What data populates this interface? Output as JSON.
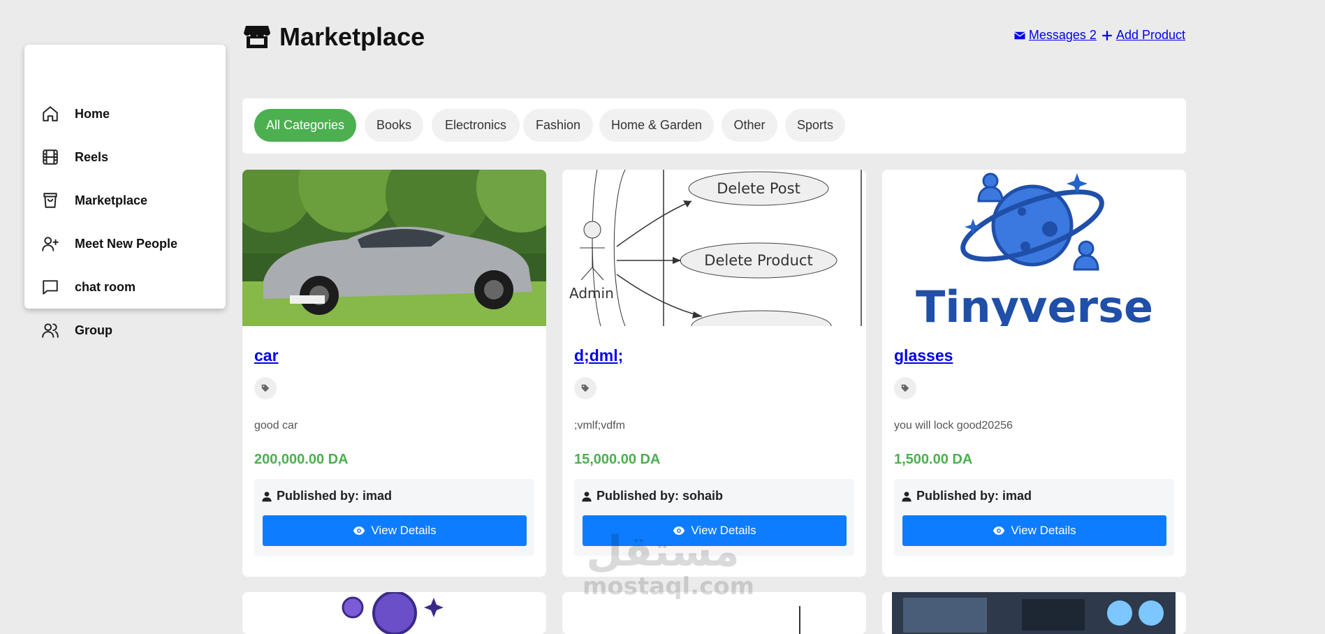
{
  "sidebar": {
    "items": [
      {
        "label": "Home",
        "icon": "home-icon"
      },
      {
        "label": "Reels",
        "icon": "film-icon"
      },
      {
        "label": "Marketplace",
        "icon": "shopping-bag-icon"
      },
      {
        "label": "Meet New People",
        "icon": "user-plus-icon"
      },
      {
        "label": "chat room",
        "icon": "chat-bubble-icon"
      },
      {
        "label": "Group",
        "icon": "users-icon"
      }
    ]
  },
  "header": {
    "title": "Marketplace",
    "messages_label": "Messages 2",
    "add_product_label": "Add Product"
  },
  "categories": {
    "items": [
      "All Categories",
      "Books",
      "Electronics",
      "Fashion",
      "Home & Garden",
      "Other",
      "Sports"
    ],
    "active": "All Categories"
  },
  "products": [
    {
      "title": "car",
      "description": "good car",
      "price": "200,000.00 DA",
      "published_by": "Published by: imad",
      "button": "View Details"
    },
    {
      "title": "d;dml;",
      "description": ";vmlf;vdfm",
      "price": "15,000.00 DA",
      "published_by": "Published by: sohaib",
      "button": "View Details"
    },
    {
      "title": "glasses",
      "description": "you will lock good20256",
      "price": "1,500.00 DA",
      "published_by": "Published by: imad",
      "button": "View Details"
    }
  ],
  "images": {
    "diagram": {
      "actor": "Admin",
      "use_case_1": "Delete Post",
      "use_case_2": "Delete Product"
    },
    "logo": {
      "text": "Tinyverse"
    }
  },
  "watermark": {
    "arabic": "مستقل",
    "latin": "mostaql.com"
  },
  "colors": {
    "accent_green": "#4caf50",
    "button_blue": "#0d7cff",
    "link_blue": "#0000ee",
    "background": "#ebebeb",
    "logo_blue": "#2563c9"
  }
}
